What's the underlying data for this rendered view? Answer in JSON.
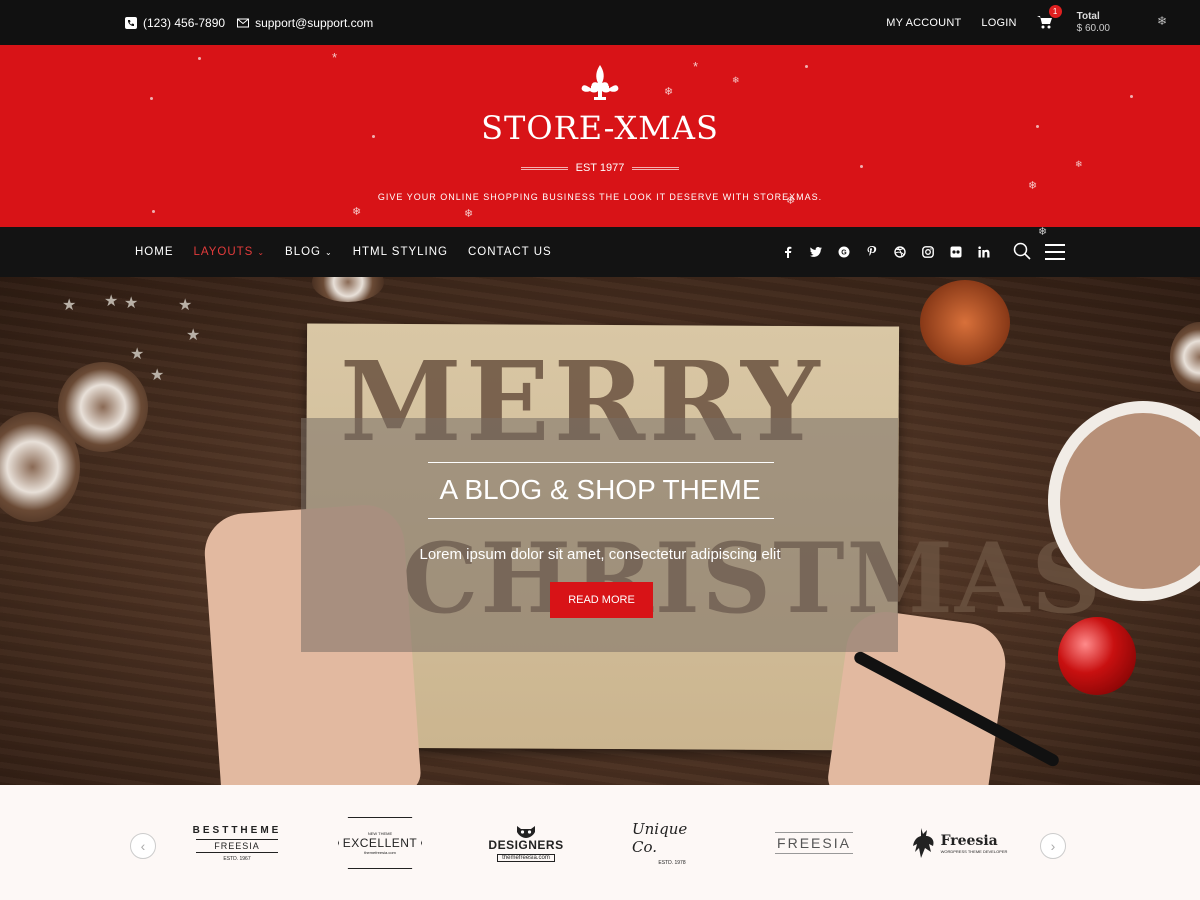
{
  "topbar": {
    "phone": "(123) 456-7890",
    "email": "support@support.com",
    "my_account": "MY ACCOUNT",
    "login": "LOGIN",
    "cart_count": "1",
    "total_label": "Total",
    "total_value": "$ 60.00"
  },
  "header": {
    "title": "STORE-XMAS",
    "est": "EST 1977",
    "tagline": "GIVE YOUR ONLINE SHOPPING BUSINESS THE LOOK IT DESERVE WITH STOREXMAS."
  },
  "nav": {
    "items": [
      {
        "label": "HOME"
      },
      {
        "label": "LAYOUTS"
      },
      {
        "label": "BLOG"
      },
      {
        "label": "HTML STYLING"
      },
      {
        "label": "CONTACT US"
      }
    ],
    "social": [
      "f",
      "t",
      "g",
      "p",
      "d",
      "i",
      "fl",
      "in"
    ]
  },
  "hero": {
    "title": "A BLOG & SHOP THEME",
    "subtitle": "Lorem ipsum dolor sit amet, consectetur adipiscing elit",
    "button": "READ MORE",
    "card_text_1": "MERRY",
    "card_text_2": "CHRISTMAS"
  },
  "partners": {
    "logos": [
      {
        "a": "BESTTHEME",
        "b": "FREESIA",
        "c": "ESTD. 1967"
      },
      {
        "a": "NEW THEME",
        "b": "EXCELLENT",
        "c": "themefreesia.com"
      },
      {
        "a": "DESIGNERS",
        "b": "themefreesia.com"
      },
      {
        "a": "Unique Co.",
        "b": "ESTD. 1978"
      },
      {
        "a": "FREESIA"
      },
      {
        "a": "Freesia",
        "b": "WORDPRESS THEME DEVELOPER"
      }
    ],
    "prev": "‹",
    "next": "›"
  },
  "colors": {
    "accent": "#d81317",
    "topbar": "#111111",
    "nav": "#131313"
  }
}
